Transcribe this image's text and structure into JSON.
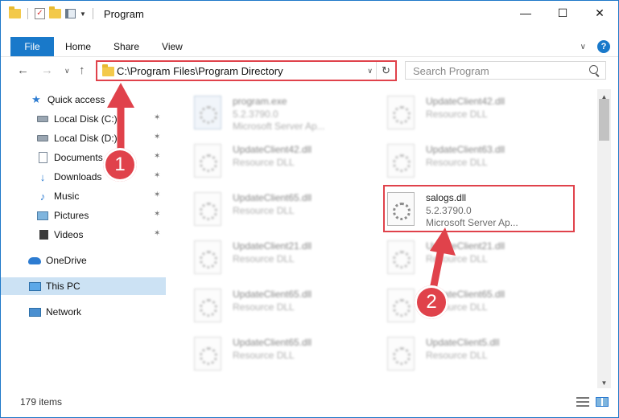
{
  "window": {
    "title": "Program",
    "minimize_glyph": "—",
    "maximize_glyph": "☐",
    "close_glyph": "✕"
  },
  "quick_access_toolbar": {
    "check_glyph": "✓",
    "dropdown_glyph": "▼"
  },
  "ribbon": {
    "tabs": [
      "File",
      "Home",
      "Share",
      "View"
    ],
    "help_glyph": "?",
    "expand_glyph": "∨"
  },
  "nav": {
    "back_glyph": "←",
    "forward_glyph": "→",
    "recent_glyph": "∨",
    "up_glyph": "↑",
    "address": "C:\\Program Files\\Program Directory",
    "address_dropdown_glyph": "∨",
    "refresh_glyph": "↻",
    "search_placeholder": "Search Program"
  },
  "sidebar": {
    "pin_glyph": "✶",
    "items": [
      {
        "label": "Quick access",
        "icon": "star-icon"
      },
      {
        "label": "Local Disk (C:)",
        "icon": "drive-icon"
      },
      {
        "label": "Local Disk (D:)",
        "icon": "drive-icon"
      },
      {
        "label": "Documents",
        "icon": "documents-icon"
      },
      {
        "label": "Downloads",
        "icon": "downloads-icon"
      },
      {
        "label": "Music",
        "icon": "music-icon"
      },
      {
        "label": "Pictures",
        "icon": "pictures-icon"
      },
      {
        "label": "Videos",
        "icon": "videos-icon"
      },
      {
        "label": "OneDrive",
        "icon": "cloud-icon"
      },
      {
        "label": "This PC",
        "icon": "computer-icon"
      },
      {
        "label": "Network",
        "icon": "network-icon"
      }
    ],
    "star_glyph": "★",
    "download_glyph": "↓",
    "music_glyph": "♪"
  },
  "files": [
    {
      "name": "program.exe",
      "line2": "5.2.3790.0",
      "line3": "Microsoft Server Ap...",
      "type": "exe"
    },
    {
      "name": "UpdateClient42.dll",
      "line2": "Resource DLL",
      "line3": ""
    },
    {
      "name": "UpdateClient42.dll",
      "line2": "Resource DLL",
      "line3": ""
    },
    {
      "name": "UpdateClient63.dll",
      "line2": "Resource DLL",
      "line3": ""
    },
    {
      "name": "UpdateClient65.dll",
      "line2": "Resource DLL",
      "line3": ""
    },
    {
      "name": "salogs.dll",
      "line2": "5.2.3790.0",
      "line3": "Microsoft Server Ap...",
      "highlighted": true
    },
    {
      "name": "UpdateClient21.dll",
      "line2": "Resource DLL",
      "line3": ""
    },
    {
      "name": "UpdateClient21.dll",
      "line2": "Resource DLL",
      "line3": ""
    },
    {
      "name": "UpdateClient65.dll",
      "line2": "Resource DLL",
      "line3": ""
    },
    {
      "name": "UpdateClient65.dll",
      "line2": "Resource DLL",
      "line3": ""
    },
    {
      "name": "UpdateClient65.dll",
      "line2": "Resource DLL",
      "line3": ""
    },
    {
      "name": "UpdateClient5.dll",
      "line2": "Resource DLL",
      "line3": ""
    }
  ],
  "status": {
    "item_count": "179 items"
  },
  "scrollbar": {
    "up_glyph": "▲",
    "down_glyph": "▼"
  },
  "annotations": {
    "badge1": "1",
    "badge2": "2",
    "color": "#e0424b"
  }
}
